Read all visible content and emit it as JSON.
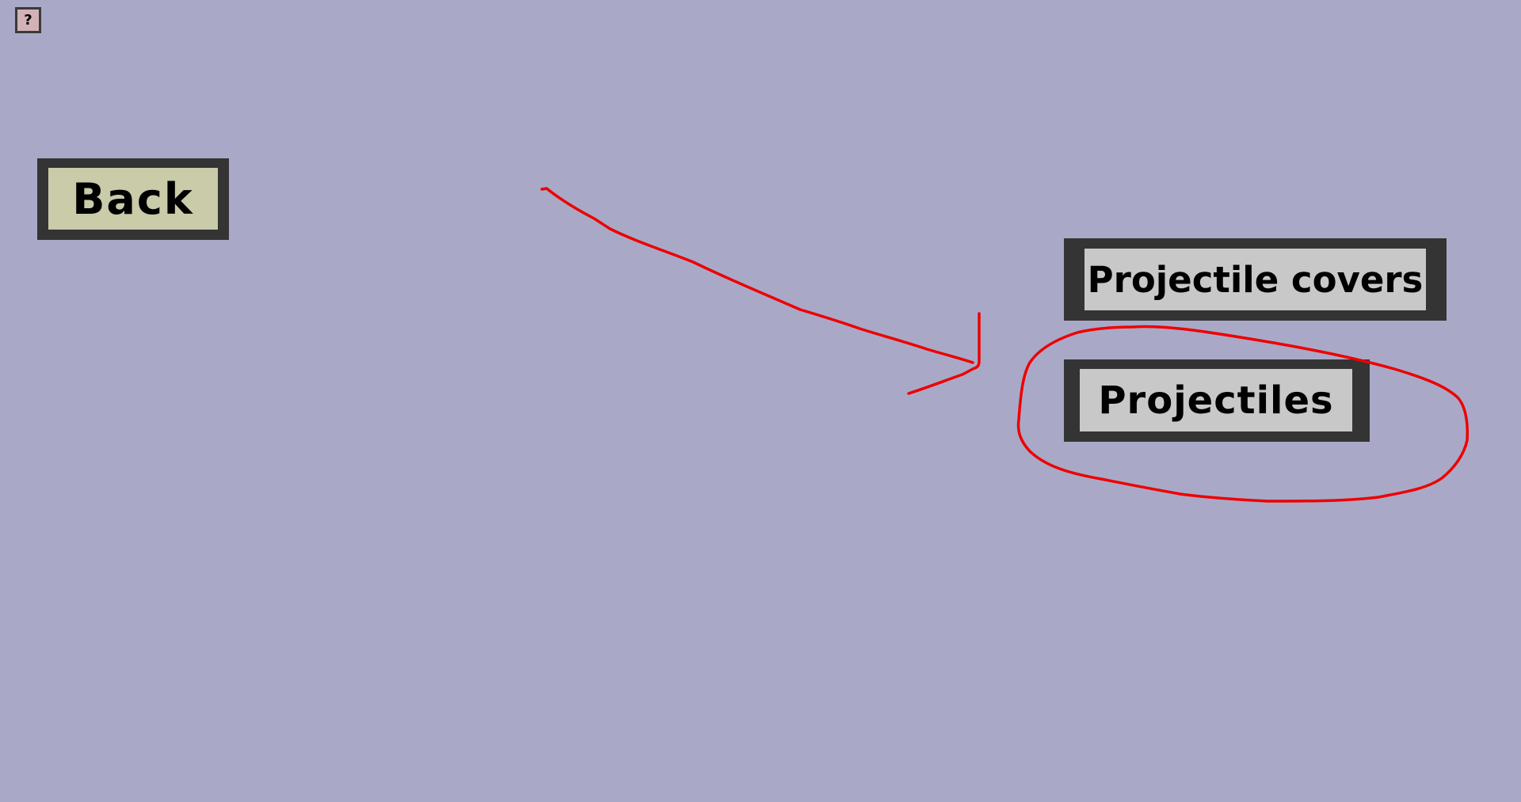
{
  "help_button": {
    "label": "?",
    "icon": "question-mark-icon"
  },
  "buttons": {
    "back": "Back",
    "projectile_covers": "Projectile covers",
    "projectiles": "Projectiles"
  },
  "colors": {
    "background": "#a9a9c7",
    "button_border": "#343434",
    "back_button_face": "#c9cba9",
    "menu_button_face": "#c8c8c8",
    "help_button_face": "#d2b1b7",
    "annotation_stroke": "#ee0000"
  }
}
